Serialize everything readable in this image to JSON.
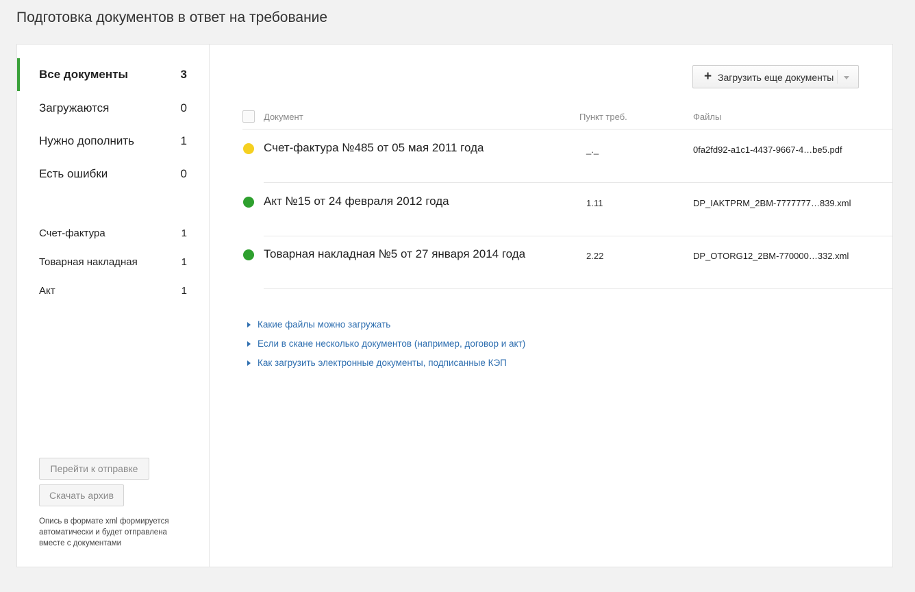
{
  "page": {
    "title": "Подготовка документов в ответ на требование"
  },
  "sidebar": {
    "filters": [
      {
        "label": "Все документы",
        "count": "3"
      },
      {
        "label": "Загружаются",
        "count": "0"
      },
      {
        "label": "Нужно дополнить",
        "count": "1"
      },
      {
        "label": "Есть ошибки",
        "count": "0"
      }
    ],
    "types": [
      {
        "label": "Счет-фактура",
        "count": "1"
      },
      {
        "label": "Товарная накладная",
        "count": "1"
      },
      {
        "label": "Акт",
        "count": "1"
      }
    ],
    "send_button": "Перейти к отправке",
    "archive_button": "Скачать архив",
    "footnote": "Опись в формате xml формируется автоматически и будет отправлена вместе с документами"
  },
  "main": {
    "upload_button": "Загрузить еще документы",
    "columns": {
      "document": "Документ",
      "punkt": "Пункт треб.",
      "files": "Файлы"
    },
    "rows": [
      {
        "status": "needs-completion",
        "status_color": "#f5d020",
        "name": "Счет-фактура №485 от 05 мая 2011 года",
        "punkt": "_._",
        "file": "0fa2fd92-a1c1-4437-9667-4…be5.pdf"
      },
      {
        "status": "ok",
        "status_color": "#2ea02e",
        "name": "Акт №15 от 24 февраля 2012 года",
        "punkt": "1.11",
        "file": "DP_IAKTPRM_2BM-7777777…839.xml"
      },
      {
        "status": "ok",
        "status_color": "#2ea02e",
        "name": "Товарная накладная №5 от 27 января 2014 года",
        "punkt": "2.22",
        "file": "DP_OTORG12_2BM-770000…332.xml"
      }
    ],
    "help_links": [
      "Какие файлы можно загружать",
      "Если в скане несколько документов (например, договор и акт)",
      "Как загрузить электронные документы, подписанные КЭП"
    ]
  },
  "colors": {
    "accent": "#3aa13a",
    "link": "#2f6fb0",
    "warning": "#f5d020",
    "success": "#2ea02e"
  }
}
